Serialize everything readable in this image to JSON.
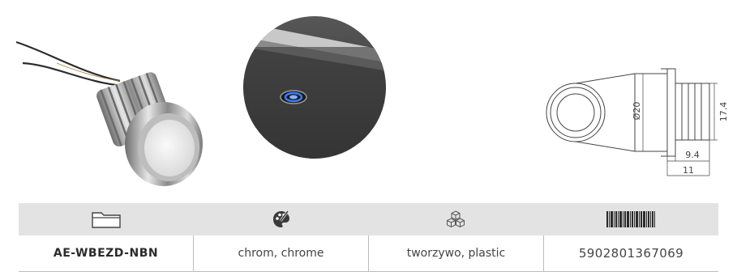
{
  "drawing": {
    "dim_diameter": "Ø20",
    "dim_height": "17.4",
    "dim_depth": "9.4",
    "dim_length": "11"
  },
  "icons": {
    "col1": "folder-icon",
    "col2": "palette-icon",
    "col3": "material-cubes-icon",
    "col4": "barcode-icon"
  },
  "specs": {
    "code": "AE-WBEZD-NBN",
    "color": "chrom, chrome",
    "material": "tworzywo, plastic",
    "ean": "5902801367069"
  }
}
